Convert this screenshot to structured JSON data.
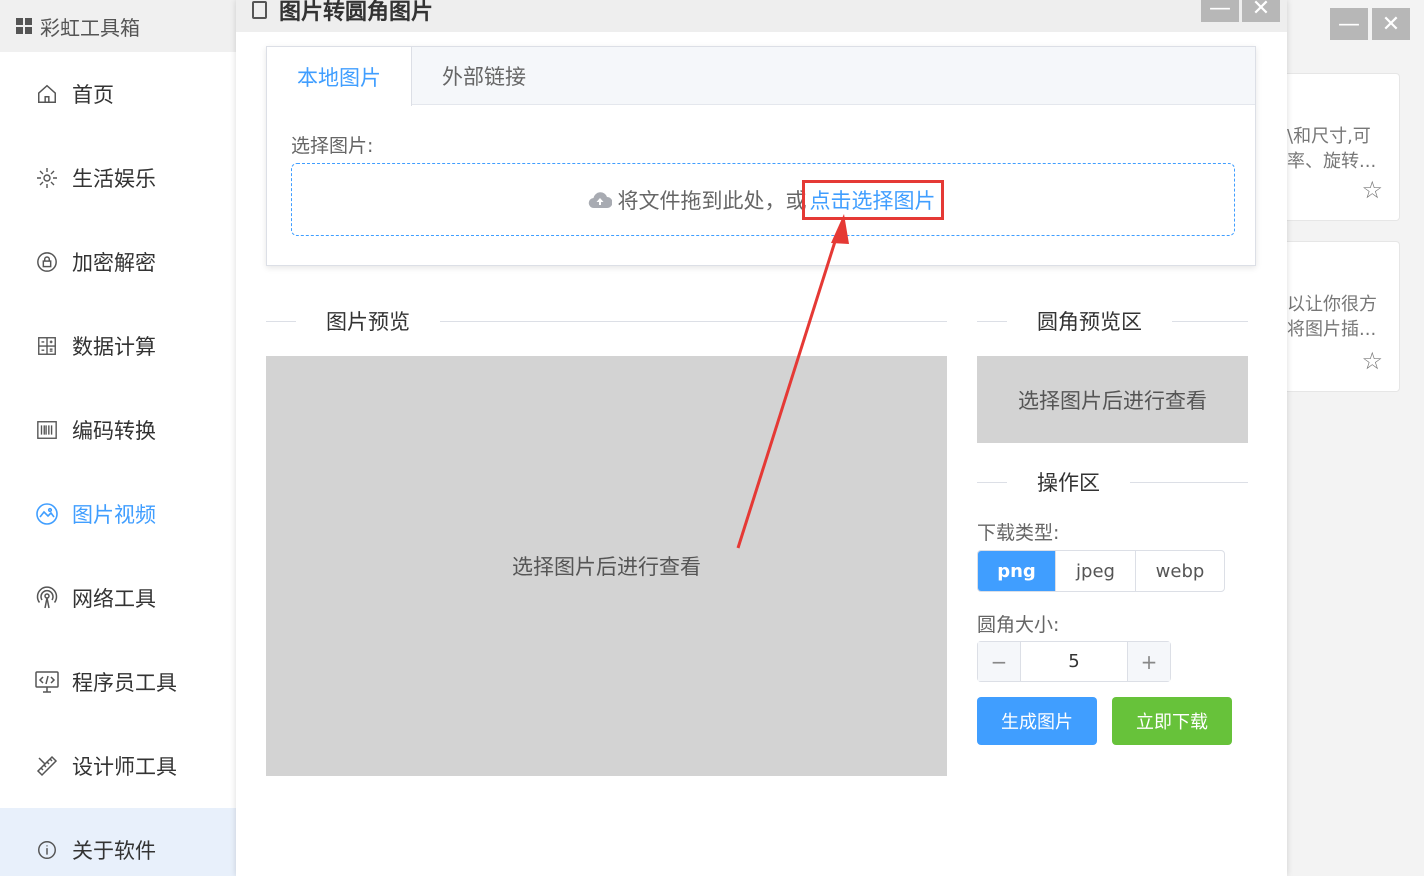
{
  "app": {
    "title": "彩虹工具箱"
  },
  "sidebar": {
    "items": [
      {
        "label": "首页"
      },
      {
        "label": "生活娱乐"
      },
      {
        "label": "加密解密"
      },
      {
        "label": "数据计算"
      },
      {
        "label": "编码转换"
      },
      {
        "label": "图片视频"
      },
      {
        "label": "网络工具"
      },
      {
        "label": "程序员工具"
      },
      {
        "label": "设计师工具"
      },
      {
        "label": "关于软件"
      }
    ]
  },
  "background_cards": [
    {
      "line1": "\\和尺寸,可",
      "line2": "率、旋转..."
    },
    {
      "line1": "以让你很方",
      "line2": "将图片插..."
    }
  ],
  "window_controls": {
    "minimize": "—",
    "close": "✕"
  },
  "dialog": {
    "title": "图片转圆角图片",
    "tabs": [
      {
        "label": "本地图片"
      },
      {
        "label": "外部链接"
      }
    ],
    "select_label": "选择图片:",
    "drop_text": "将文件拖到此处，或",
    "drop_link": "点击选择图片",
    "preview_title": "图片预览",
    "preview_placeholder": "选择图片后进行查看",
    "rounded_title": "圆角预览区",
    "rounded_placeholder": "选择图片后进行查看",
    "ops_title": "操作区",
    "download_type_label": "下载类型:",
    "download_types": [
      "png",
      "jpeg",
      "webp"
    ],
    "radius_label": "圆角大小:",
    "radius_value": "5",
    "minus": "−",
    "plus": "+",
    "generate_button": "生成图片",
    "download_button": "立即下载"
  },
  "colors": {
    "accent": "#409eff",
    "success": "#67c23a",
    "annotation": "#e53935"
  }
}
